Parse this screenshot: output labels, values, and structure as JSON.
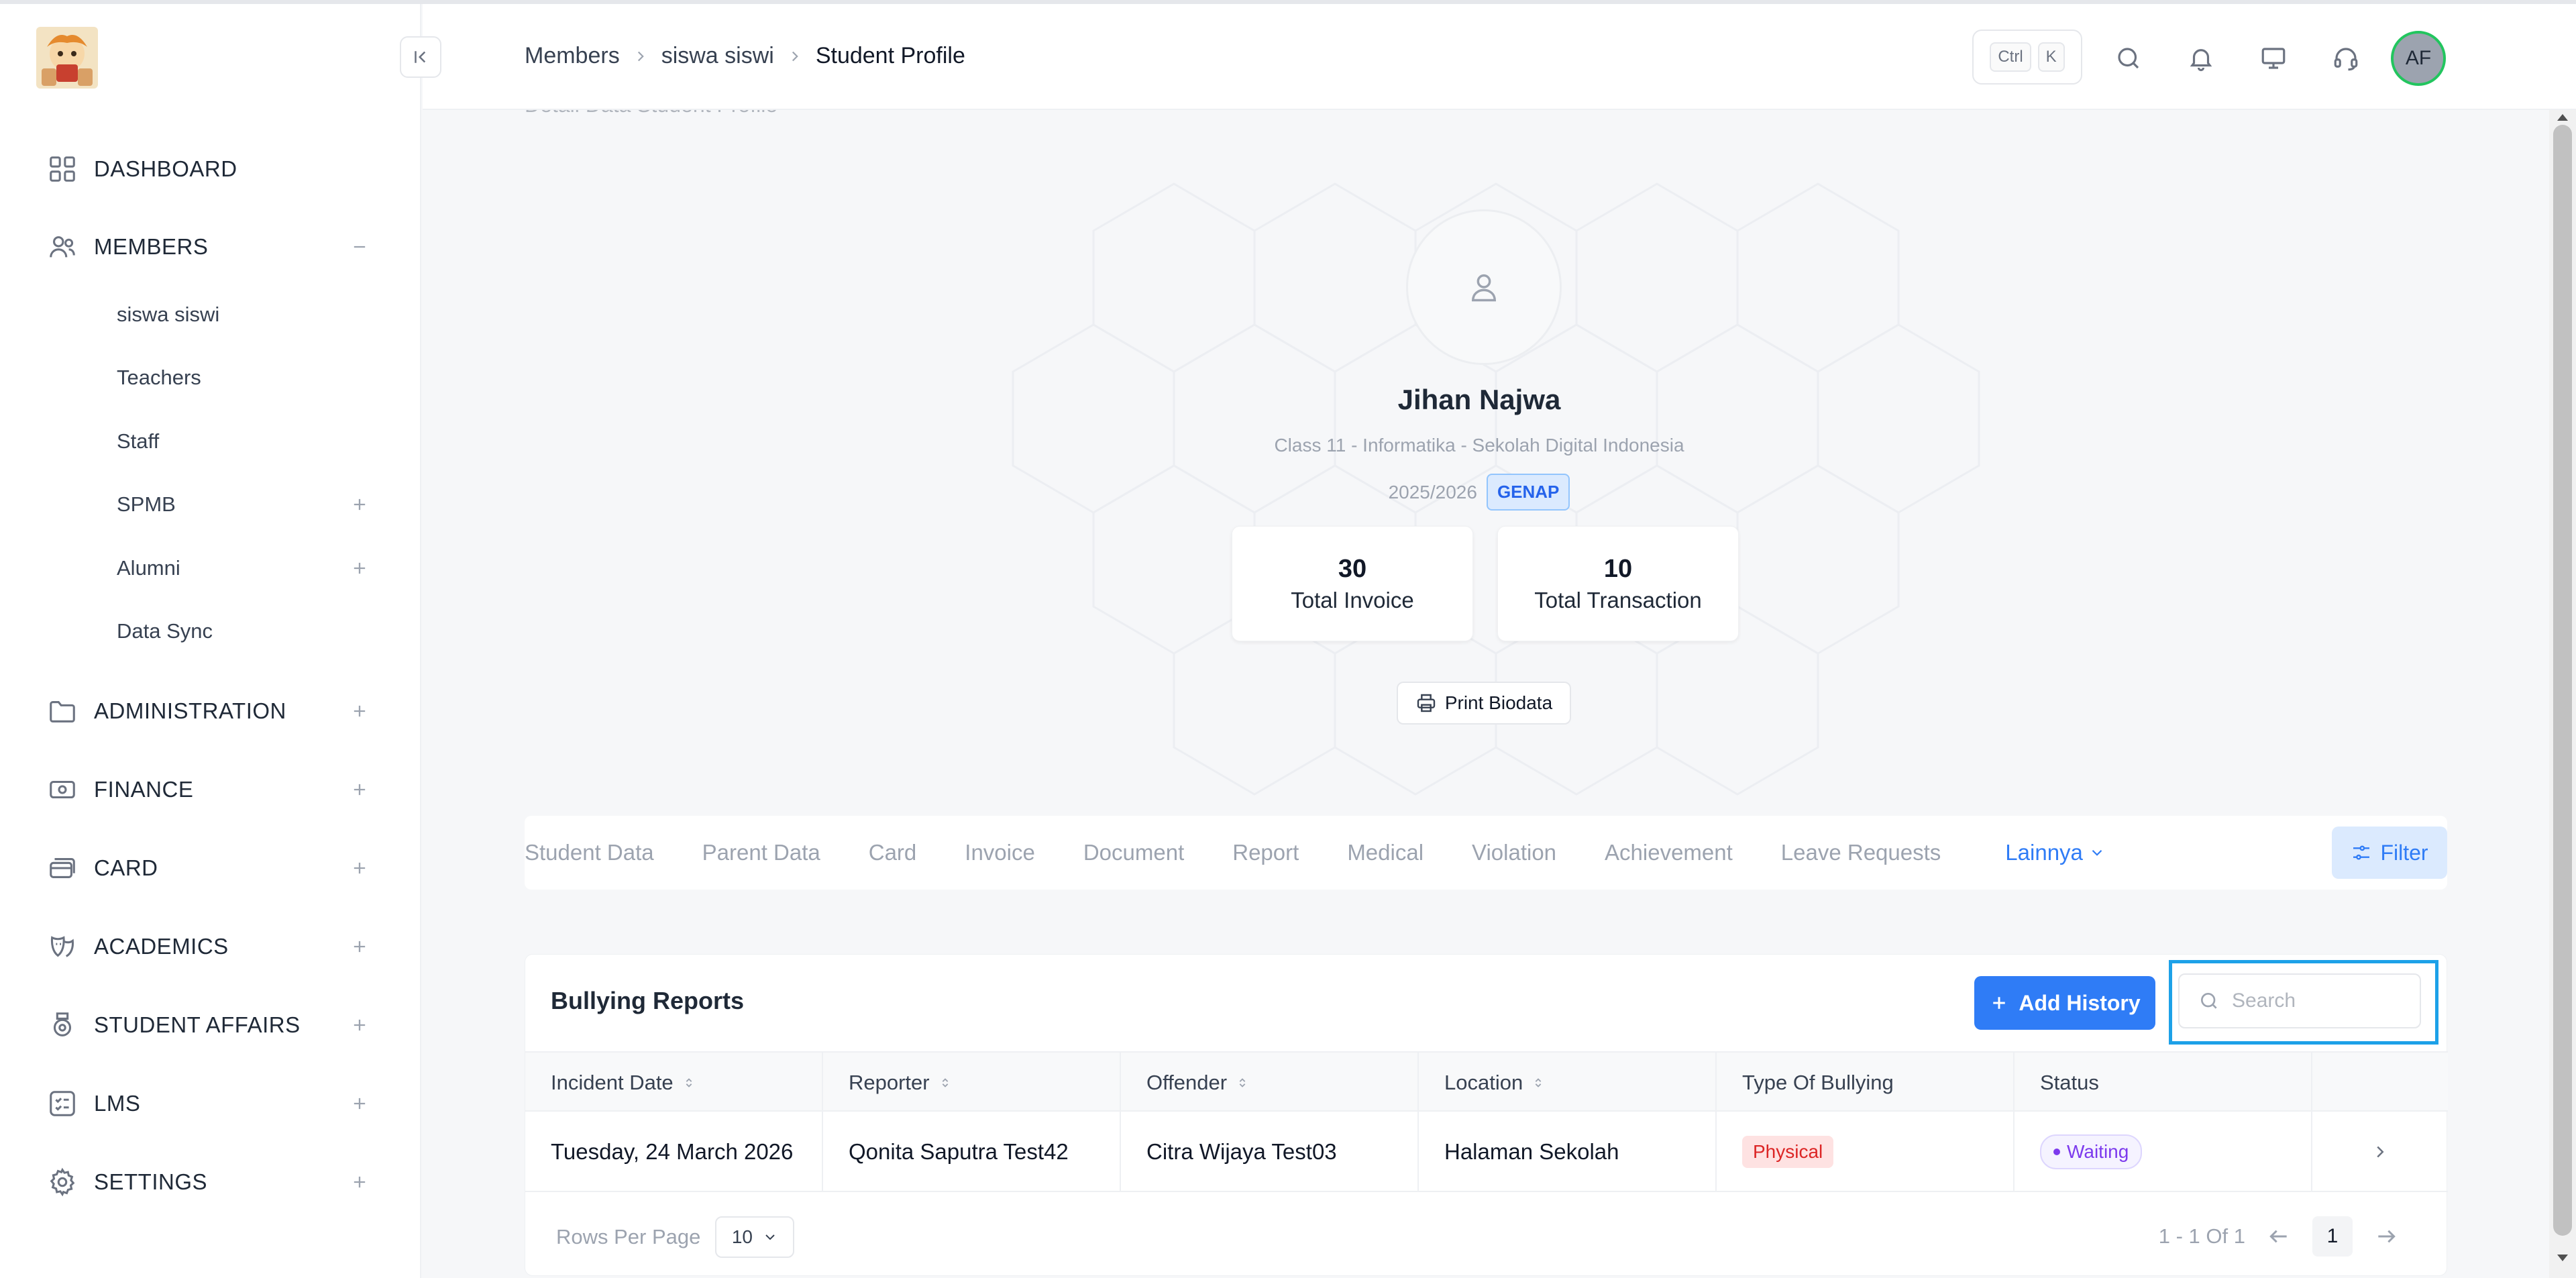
{
  "sidebar": {
    "items": [
      {
        "label": "DASHBOARD"
      },
      {
        "label": "MEMBERS"
      },
      {
        "label": "ADMINISTRATION"
      },
      {
        "label": "FINANCE"
      },
      {
        "label": "CARD"
      },
      {
        "label": "ACADEMICS"
      },
      {
        "label": "STUDENT AFFAIRS"
      },
      {
        "label": "LMS"
      },
      {
        "label": "SETTINGS"
      }
    ],
    "members_sub": [
      {
        "label": "siswa siswi"
      },
      {
        "label": "Teachers"
      },
      {
        "label": "Staff"
      },
      {
        "label": "SPMB"
      },
      {
        "label": "Alumni"
      },
      {
        "label": "Data Sync"
      }
    ]
  },
  "header": {
    "breadcrumb": [
      "Members",
      "siswa siswi",
      "Student Profile"
    ],
    "shortcut_ctrl": "Ctrl",
    "shortcut_key": "K",
    "avatar_initials": "AF"
  },
  "profile": {
    "section_caption": "Detail Data Student Profile",
    "name": "Jihan Najwa",
    "class_line": "Class 11 - Informatika - Sekolah Digital Indonesia",
    "year": "2025/2026",
    "semester_badge": "GENAP",
    "stats": [
      {
        "value": "30",
        "label": "Total Invoice"
      },
      {
        "value": "10",
        "label": "Total Transaction"
      }
    ],
    "print_label": "Print Biodata"
  },
  "tabs": {
    "items": [
      "Student Data",
      "Parent Data",
      "Card",
      "Invoice",
      "Document",
      "Report",
      "Medical",
      "Violation",
      "Achievement",
      "Leave Requests"
    ],
    "more_label": "Lainnya",
    "filter_label": "Filter"
  },
  "bullying": {
    "title": "Bullying Reports",
    "add_label": "Add History",
    "search_placeholder": "Search",
    "columns": [
      "Incident Date",
      "Reporter",
      "Offender",
      "Location",
      "Type Of Bullying",
      "Status"
    ],
    "rows": [
      {
        "incident_date": "Tuesday, 24 March 2026",
        "reporter": "Qonita Saputra Test42",
        "offender": "Citra Wijaya Test03",
        "location": "Halaman Sekolah",
        "type": "Physical",
        "status": "Waiting"
      }
    ],
    "rows_per_page_label": "Rows Per Page",
    "rows_per_page_value": "10",
    "range_text": "1 - 1 Of 1",
    "current_page": "1"
  },
  "colors": {
    "accent": "#2f7cf6",
    "danger": "#dc2626",
    "waiting": "#7c3aed",
    "focus": "#1da1e8",
    "avatar_ring": "#22c55e"
  }
}
